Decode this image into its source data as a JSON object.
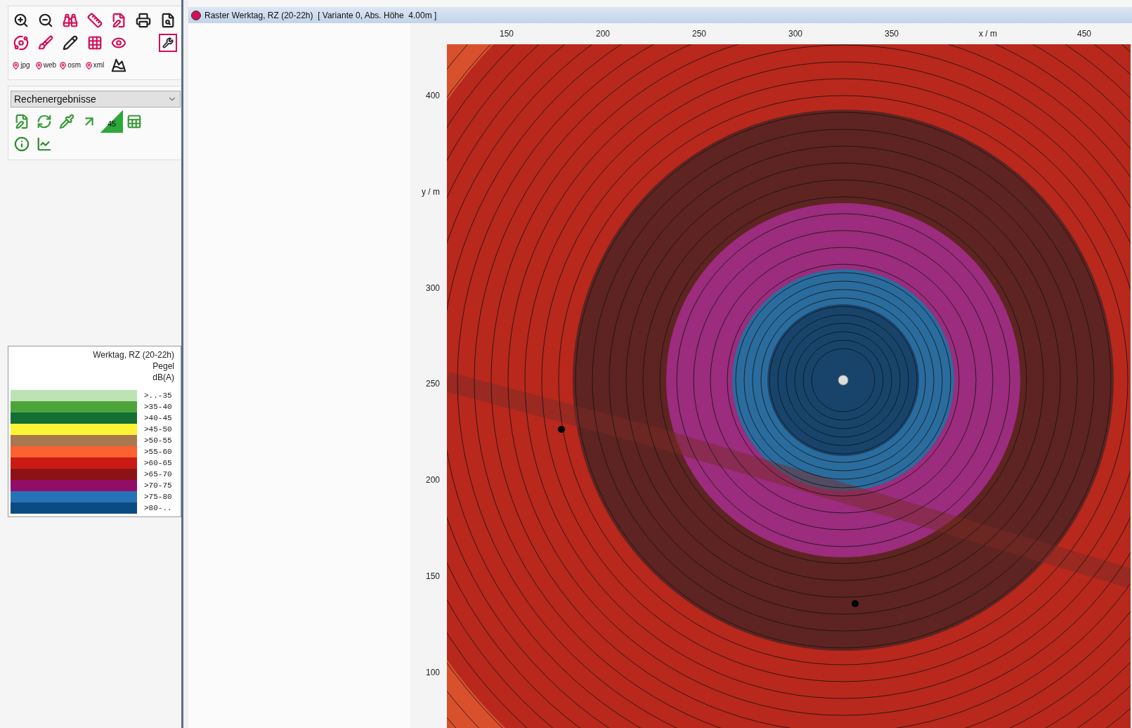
{
  "toolbar": {
    "export_buttons": [
      "jpg",
      "web",
      "osm",
      "xml"
    ]
  },
  "layer_select": {
    "value": "Rechenergebnisse"
  },
  "result_tools": {
    "slope_label": "45"
  },
  "legend": {
    "title": "Werktag, RZ (20-22h)",
    "quantity": "Pegel",
    "unit": "dB(A)",
    "items": [
      {
        "label": ">..-35",
        "color": "#bde3b4"
      },
      {
        "label": ">35-40",
        "color": "#4da53a"
      },
      {
        "label": ">40-45",
        "color": "#136f34"
      },
      {
        "label": ">45-50",
        "color": "#fcf434"
      },
      {
        "label": ">50-55",
        "color": "#a8784e"
      },
      {
        "label": ">55-60",
        "color": "#fc6132"
      },
      {
        "label": ">60-65",
        "color": "#c91b14"
      },
      {
        "label": ">65-70",
        "color": "#8c1216"
      },
      {
        "label": ">70-75",
        "color": "#920e66"
      },
      {
        "label": ">75-80",
        "color": "#2673b8"
      },
      {
        "label": ">80-..",
        "color": "#0b4a82"
      }
    ]
  },
  "window": {
    "title": "Raster Werktag, RZ (20-22h)  [ Variante 0, Abs. Höhe  4.00m ]"
  },
  "axes": {
    "x_ticks": [
      "150",
      "200",
      "250",
      "300",
      "350",
      "x / m",
      "450"
    ],
    "y_ticks": [
      "400",
      "y / m",
      "300",
      "250",
      "200",
      "150",
      "100"
    ]
  }
}
